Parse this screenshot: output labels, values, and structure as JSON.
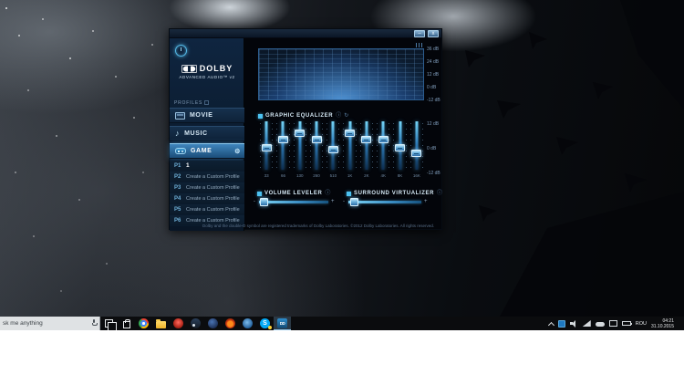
{
  "colors": {
    "accent": "#4cc2f1",
    "selected_profile": "#2f74ad",
    "window_bg": "#04070c",
    "taskbar_bg": "#0b0c0e",
    "search_bg": "#dfe2e4",
    "eq_handle": "#6fb6e0"
  },
  "window": {
    "title_bar": {
      "minimize": "–",
      "close": "x"
    },
    "brand": {
      "logo": "DOLBY",
      "tagline": "ADVANCED AUDIO™ v2"
    },
    "profiles": {
      "header": "PROFILES",
      "items": [
        {
          "id": "movie",
          "label": "MOVIE",
          "icon": "film-icon",
          "selected": false
        },
        {
          "id": "music",
          "label": "MUSIC",
          "icon": "music-note-icon",
          "selected": false
        },
        {
          "id": "game",
          "label": "GAME",
          "icon": "gamepad-icon",
          "selected": true,
          "gear": "⚙"
        }
      ],
      "custom": [
        {
          "key": "P1",
          "label": "1",
          "named": true
        },
        {
          "key": "P2",
          "label": "Create a Custom Profile",
          "named": false
        },
        {
          "key": "P3",
          "label": "Create a Custom Profile",
          "named": false
        },
        {
          "key": "P4",
          "label": "Create a Custom Profile",
          "named": false
        },
        {
          "key": "P5",
          "label": "Create a Custom Profile",
          "named": false
        },
        {
          "key": "P6",
          "label": "Create a Custom Profile",
          "named": false
        }
      ]
    },
    "spectrum": {
      "scale": [
        "36 dB",
        "24 dB",
        "12 dB",
        "0 dB",
        "-12 dB"
      ]
    },
    "equalizer": {
      "title": "GRAPHIC EQUALIZER",
      "info_icon": "ⓘ",
      "reset_icon": "↻",
      "bands": [
        "33",
        "66",
        "130",
        "260",
        "510",
        "1K",
        "2K",
        "4K",
        "8K",
        "16K"
      ],
      "values_db": [
        -1,
        3,
        6,
        3,
        -2,
        6,
        3,
        3,
        -1,
        -4
      ],
      "range_db": [
        -12,
        12
      ],
      "scale": [
        "12 dB",
        "0 dB",
        "-12 dB"
      ]
    },
    "volume_leveler": {
      "title": "VOLUME LEVELER",
      "info_icon": "ⓘ",
      "minus": "-",
      "plus": "+",
      "value_pct": 7
    },
    "surround_virtualizer": {
      "title": "SURROUND VIRTUALIZER",
      "info_icon": "ⓘ",
      "minus": "-",
      "plus": "+",
      "value_pct": 8
    },
    "footer": "Dolby and the double-D symbol are registered trademarks of Dolby Laboratories. ©2012 Dolby Laboratories. All rights reserved."
  },
  "taskbar": {
    "search": {
      "value": "sk me anything"
    },
    "apps": [
      {
        "name": "task-view",
        "active": false,
        "badge": false,
        "glyph": ""
      },
      {
        "name": "store",
        "active": false,
        "badge": false,
        "glyph": ""
      },
      {
        "name": "chrome",
        "active": false,
        "badge": false,
        "glyph": ""
      },
      {
        "name": "file-explorer",
        "active": false,
        "badge": false,
        "glyph": ""
      },
      {
        "name": "media-red",
        "active": false,
        "badge": false,
        "glyph": ""
      },
      {
        "name": "steam",
        "active": false,
        "badge": false,
        "glyph": ""
      },
      {
        "name": "planet",
        "active": false,
        "badge": false,
        "glyph": ""
      },
      {
        "name": "flame",
        "active": false,
        "badge": false,
        "glyph": ""
      },
      {
        "name": "blue-app",
        "active": false,
        "badge": false,
        "glyph": ""
      },
      {
        "name": "skype",
        "active": false,
        "badge": true,
        "glyph": "S"
      },
      {
        "name": "dolby",
        "active": true,
        "badge": false,
        "glyph": "DD"
      }
    ],
    "tray": {
      "icons": [
        "chevron",
        "dolby",
        "speaker",
        "network",
        "cloud",
        "display",
        "battery"
      ],
      "language": "ROU",
      "time": "04:21",
      "date": "31.10.2015"
    }
  }
}
